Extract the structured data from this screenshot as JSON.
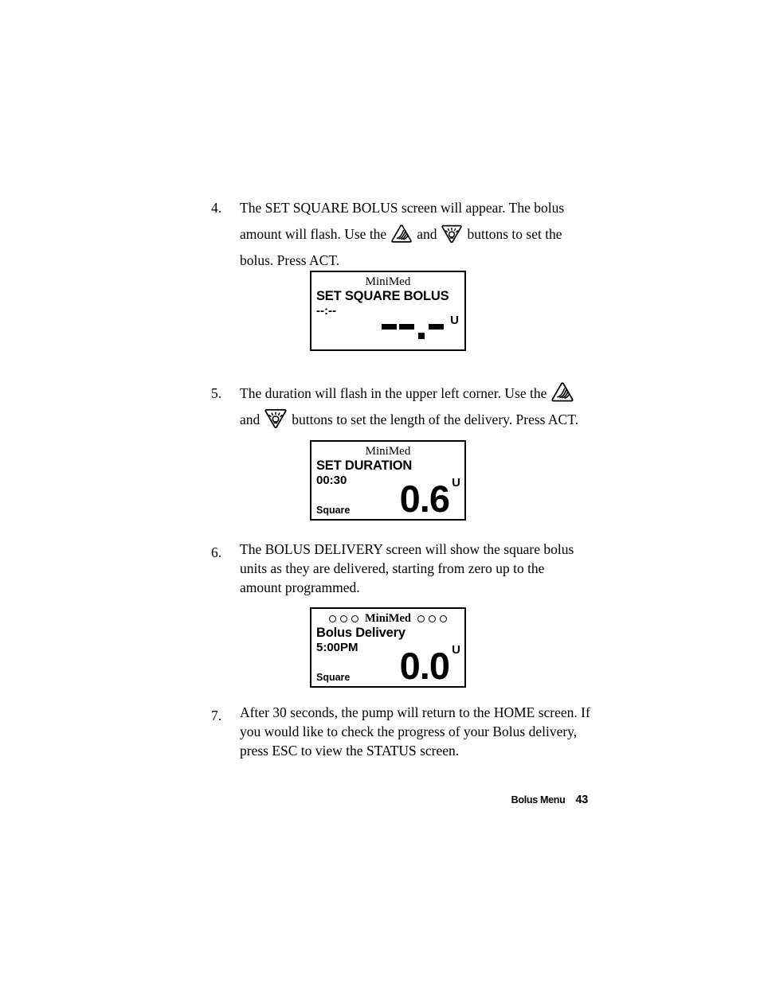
{
  "page": {
    "footer_section": "Bolus Menu",
    "footer_page_number": "43"
  },
  "steps": [
    {
      "number": "4.",
      "text_part_1": "The SET SQUARE BOLUS screen will appear. The bolus amount will flash. Use the",
      "conjunction": "and",
      "text_part_2": "buttons to set the bolus. Press ACT.",
      "icon_up": "up-arrow-button-icon",
      "icon_down": "down-arrow-button-icon"
    },
    {
      "number": "5.",
      "text_part_1": "The duration will flash in the upper left corner. Use the",
      "conjunction": "and",
      "text_part_2": "buttons to set the length of the delivery. Press ACT.",
      "icon_up": "up-arrow-button-icon",
      "icon_down": "down-arrow-button-icon"
    },
    {
      "number": "6.",
      "text_part_1": "The BOLUS DELIVERY screen will show the square bolus units as they are delivered, starting from zero up to the amount programmed."
    },
    {
      "number": "7.",
      "text_part_1": "After 30 seconds, the pump will return to the HOME screen. If you would like to check the progress of your Bolus delivery, press ESC to view the STATUS screen."
    }
  ],
  "screens": [
    {
      "brand": "MiniMed",
      "title": "SET SQUARE BOLUS",
      "sub": "--:--",
      "unit": "U",
      "value_is_blank": true
    },
    {
      "brand": "MiniMed",
      "title": "SET DURATION",
      "sub": "00:30",
      "mode": "Square",
      "value": "0.6",
      "unit": "U"
    },
    {
      "brand": "MiniMed",
      "title": "Bolus Delivery",
      "sub": "5:00PM",
      "mode": "Square",
      "value": "0.0",
      "unit": "U",
      "indicator_count_left": 3,
      "indicator_count_right": 3
    }
  ],
  "colors": {
    "ink": "#000000",
    "paper": "#ffffff"
  }
}
